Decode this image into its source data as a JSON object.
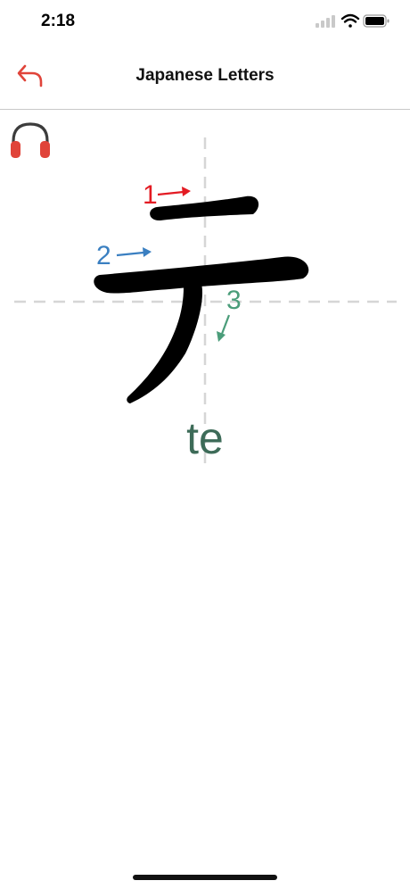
{
  "status_bar": {
    "time": "2:18",
    "icons": [
      "signal-icon",
      "wifi-icon",
      "battery-icon"
    ]
  },
  "nav": {
    "title": "Japanese Letters",
    "back_icon": "back-arrow-icon",
    "accent_color": "#e0443a"
  },
  "audio": {
    "icon": "headphones-icon"
  },
  "letter": {
    "character": "テ",
    "romaji": "te",
    "romaji_color": "#3d6b58",
    "strokes": [
      {
        "number": "1",
        "color": "#e31b23"
      },
      {
        "number": "2",
        "color": "#3a7fc1"
      },
      {
        "number": "3",
        "color": "#4b9d7a"
      }
    ]
  }
}
